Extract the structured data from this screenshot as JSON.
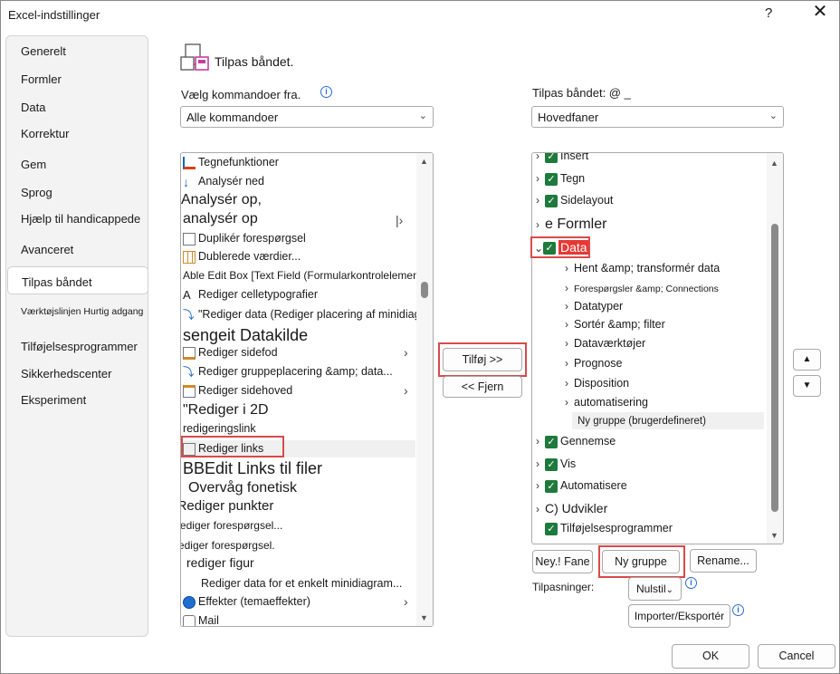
{
  "window": {
    "title": "Excel-indstillinger",
    "help": "?",
    "close": "✕"
  },
  "nav": {
    "items": [
      "Generelt",
      "Formler",
      "Data",
      "Korrektur",
      "Gem",
      "Sprog",
      "Hjælp til handicappede",
      "Avanceret",
      "Tilpas båndet",
      "Værktøjslinjen Hurtig adgang",
      "Tilføjelsesprogrammer",
      "Sikkerhedscenter",
      "Eksperiment"
    ]
  },
  "header": {
    "title": "Tilpas båndet."
  },
  "left": {
    "label": "Vælg kommandoer fra.",
    "combo_value": "Alle kommandoer",
    "items": [
      "Tegnefunktioner",
      "Analysér ned",
      "Analysér op,",
      "analysér op",
      "Duplikér forespørgsel",
      "Dublerede værdier...",
      "Able Edit Box [Text Field (Formularkontrolelement))",
      "Rediger celletypografier",
      "\"Rediger data (Rediger placering af minidiagram",
      "sengeit Datakilde",
      "Rediger sidefod",
      "Rediger gruppeplacering &amp; data...",
      "Rediger sidehoved",
      "\"Rediger i 2D",
      "redigeringslink",
      "Rediger links",
      "BBEdit Links til filer",
      "Overvåg fonetisk",
      "•. Rediger punkter",
      "\"Rediger forespørgsel...",
      "\"Rediger forespørgsel.",
      "rediger figur",
      "Rediger data for et enkelt minidiagram...",
      "Effekter (temaeffekter)",
      "Mail"
    ]
  },
  "middle": {
    "add": "Tilføj >>",
    "remove": "<< Fjern"
  },
  "right": {
    "label": "Tilpas båndet: @ _",
    "combo_value": "Hovedfaner",
    "items": [
      "Insert",
      "Tegn",
      "Sidelayout",
      "e Formler",
      "Data",
      "Hent &amp; transformér data",
      "Forespørgsler &amp; Connections",
      "Datatyper",
      "Sortér &amp; filter",
      "Dataværktøjer",
      "Prognose",
      "Disposition",
      "automatisering",
      "Ny gruppe (brugerdefineret)",
      "Gennemse",
      "Vis",
      "Automatisere",
      "C) Udvikler",
      "Tilføjelsesprogrammer"
    ],
    "new_tab": "Ney.! Fane",
    "new_group": "Ny gruppe",
    "rename": "Rename...",
    "customizations_label": "Tilpasninger:",
    "reset": "Nulstil",
    "import_export": "Importer/Eksportér",
    "up": "▲",
    "down": "▼"
  },
  "footer": {
    "ok": "OK",
    "cancel": "Cancel"
  }
}
